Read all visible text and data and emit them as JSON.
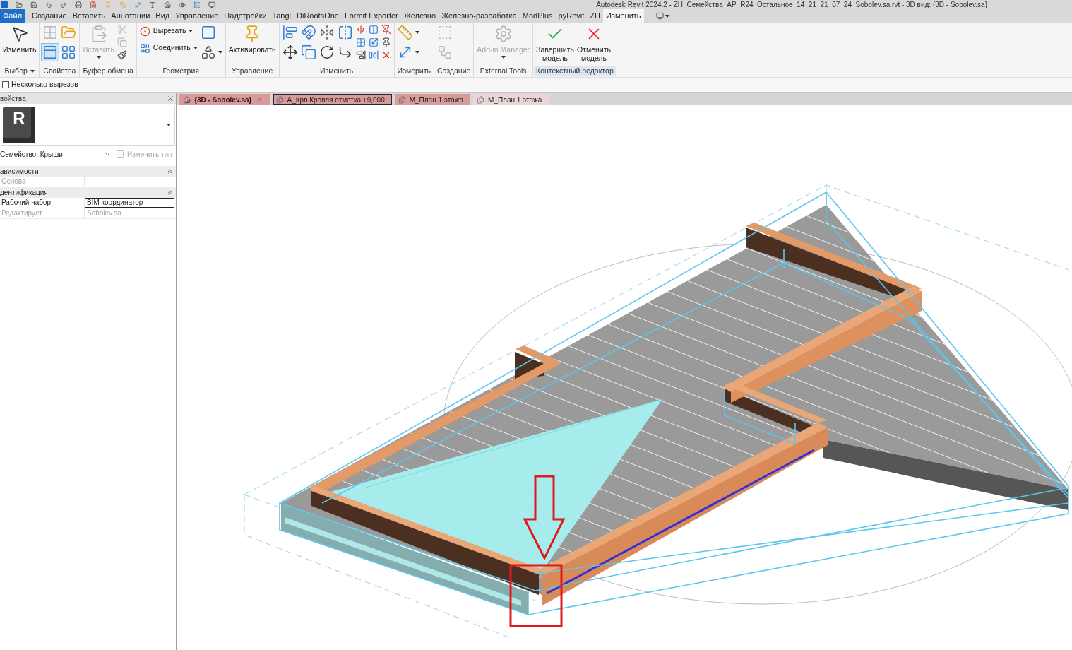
{
  "title_bar": {
    "title": "Autodesk Revit 2024.2 - ZH_Семейства_АР_R24_Остальное_14_21_21_07_24_Sobolev.sa.rvt - 3D вид: {3D - Sobolev.sa}"
  },
  "menu_tabs": [
    {
      "label": "Файл",
      "kind": "file",
      "selected": false
    },
    {
      "label": "Создание",
      "kind": "tab",
      "selected": false
    },
    {
      "label": "Вставить",
      "kind": "tab",
      "selected": false
    },
    {
      "label": "Аннотации",
      "kind": "tab",
      "selected": false
    },
    {
      "label": "Вид",
      "kind": "tab",
      "selected": false
    },
    {
      "label": "Управление",
      "kind": "tab",
      "selected": false
    },
    {
      "label": "Надстройки",
      "kind": "tab",
      "selected": false
    },
    {
      "label": "Tangl",
      "kind": "tab",
      "selected": false
    },
    {
      "label": "DiRootsOne",
      "kind": "tab",
      "selected": false
    },
    {
      "label": "Formit Exporter",
      "kind": "tab",
      "selected": false
    },
    {
      "label": "Железно",
      "kind": "tab",
      "selected": false
    },
    {
      "label": "Железно-разработка",
      "kind": "tab",
      "selected": false
    },
    {
      "label": "ModPlus",
      "kind": "tab",
      "selected": false
    },
    {
      "label": "pyRevit",
      "kind": "tab",
      "selected": false
    },
    {
      "label": "ZH",
      "kind": "tab",
      "selected": false
    },
    {
      "label": "Изменить",
      "kind": "tab",
      "selected": true
    }
  ],
  "ribbon": {
    "panels": [
      {
        "title": "Выбор",
        "menu": true,
        "columns": [
          [
            {
              "kind": "large",
              "label": "Изменить",
              "disabled": false
            }
          ]
        ]
      },
      {
        "title": "Свойства",
        "columns": [
          [
            {
              "kind": "icon",
              "disabled": true
            },
            {
              "kind": "icon",
              "disabled": false,
              "on": true
            }
          ],
          [
            {
              "kind": "icon",
              "disabled": false
            },
            {
              "kind": "icon",
              "disabled": false
            }
          ]
        ]
      },
      {
        "title": "Буфер обмена",
        "columns": [
          [
            {
              "kind": "large",
              "label": "Вставить",
              "disabled": true,
              "menu": true
            }
          ],
          [
            {
              "kind": "icon",
              "disabled": true
            },
            {
              "kind": "icon",
              "disabled": true
            },
            {
              "kind": "icon",
              "disabled": false
            }
          ]
        ]
      },
      {
        "title": "Геометрия",
        "columns": [
          [
            {
              "kind": "small",
              "label": "Вырезать",
              "disabled": false,
              "menu": true
            },
            {
              "kind": "small",
              "label": "Соединить",
              "disabled": false,
              "menu": true
            }
          ],
          [
            {
              "kind": "icon",
              "disabled": false
            },
            {
              "kind": "icon",
              "disabled": false,
              "menu": true
            }
          ]
        ]
      },
      {
        "title": "Управление",
        "columns": [
          [
            {
              "kind": "large",
              "label": "Активировать",
              "disabled": false
            }
          ]
        ]
      },
      {
        "title": "Изменить",
        "columns": [
          [
            {
              "kind": "icon",
              "disabled": false
            },
            {
              "kind": "icon",
              "disabled": false
            }
          ],
          [
            {
              "kind": "icon",
              "disabled": false
            },
            {
              "kind": "icon",
              "disabled": false
            }
          ],
          [
            {
              "kind": "icon",
              "disabled": false
            },
            {
              "kind": "icon",
              "disabled": false
            }
          ],
          [
            {
              "kind": "icon",
              "disabled": false
            },
            {
              "kind": "icon",
              "disabled": false
            }
          ],
          [
            {
              "kind": "icon",
              "disabled": false
            },
            {
              "kind": "icon",
              "disabled": false
            },
            {
              "kind": "icon",
              "disabled": false
            }
          ],
          [
            {
              "kind": "icon",
              "disabled": false
            },
            {
              "kind": "icon",
              "disabled": false
            },
            {
              "kind": "icon",
              "disabled": false
            }
          ],
          [
            {
              "kind": "icon",
              "disabled": false
            },
            {
              "kind": "icon",
              "disabled": false
            },
            {
              "kind": "icon",
              "disabled": false
            }
          ]
        ]
      },
      {
        "title": "Измерить",
        "columns": [
          [
            {
              "kind": "icon",
              "disabled": false,
              "menu": true
            },
            {
              "kind": "icon",
              "disabled": false,
              "menu": true
            }
          ]
        ]
      },
      {
        "title": "Создание",
        "columns": [
          [
            {
              "kind": "icon",
              "disabled": true
            },
            {
              "kind": "icon",
              "disabled": true
            }
          ]
        ]
      },
      {
        "title": "External Tools",
        "columns": [
          [
            {
              "kind": "large",
              "label": "Add-in Manager",
              "disabled": true,
              "menu": true
            }
          ]
        ]
      },
      {
        "title": "Контекстный редактор",
        "highlighted": true,
        "columns": [
          [
            {
              "kind": "large",
              "label": "Завершить\nмодель",
              "disabled": false
            }
          ],
          [
            {
              "kind": "large",
              "label": "Отменить\nмодель",
              "disabled": false
            }
          ]
        ]
      }
    ]
  },
  "options_bar": {
    "checkbox": {
      "label": "Несколько вырезов",
      "checked": false
    }
  },
  "properties": {
    "title": "войства",
    "type_logo": "R",
    "family": "Семейство: Крыши",
    "edit_type": {
      "label": "Изменить тип",
      "disabled": true
    },
    "groups": [
      {
        "title": "ависимости",
        "expanded": true,
        "rows": [
          {
            "label": "Основа",
            "disabled": true,
            "editing": false
          }
        ]
      },
      {
        "title": "дентификация",
        "expanded": true,
        "rows": [
          {
            "label": "Рабочий набор",
            "value": "BIM координатор",
            "disabled": false,
            "editing": true
          },
          {
            "label": "Редактирует",
            "value": "Sobolev.sa",
            "disabled": true,
            "editing": false
          }
        ]
      }
    ]
  },
  "view_tabs": [
    {
      "label": "{3D - Sobolev.sa}",
      "kind": "model",
      "selected": true,
      "focused": false,
      "color": "#d99a9a"
    },
    {
      "label": "А_Крв Кровля отметка +9,000",
      "kind": "plan",
      "selected": false,
      "focused": true,
      "color": "#d99a9a"
    },
    {
      "label": "М_План 1 этажа",
      "kind": "plan",
      "selected": false,
      "focused": false,
      "color": "#d99a9a"
    },
    {
      "label": "М_План 1 этажа",
      "kind": "plan",
      "selected": false,
      "focused": false,
      "color": "#ead6d6"
    }
  ]
}
